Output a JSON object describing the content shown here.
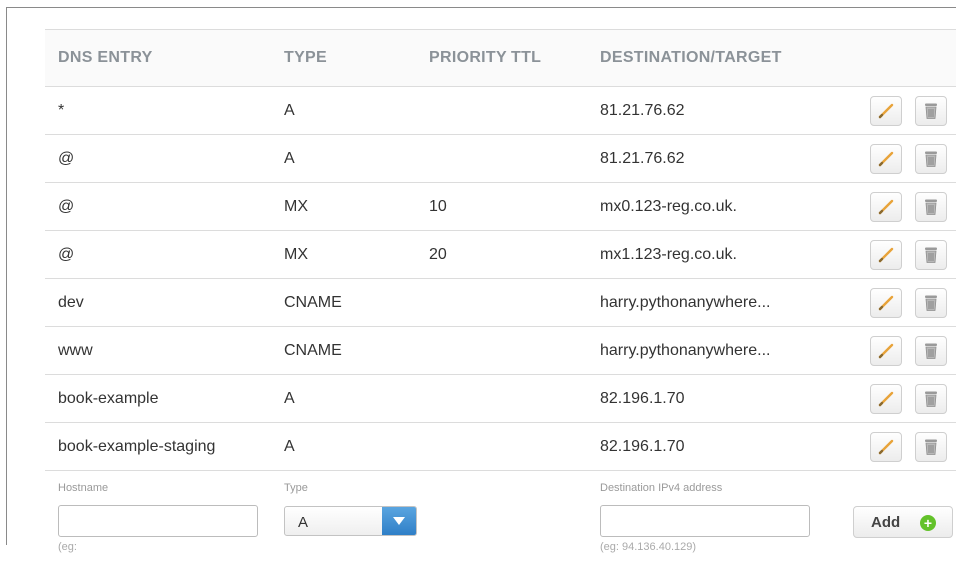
{
  "table": {
    "headers": {
      "entry": "DNS ENTRY",
      "type": "TYPE",
      "priority": "PRIORITY",
      "ttl": "TTL",
      "destination": "DESTINATION/TARGET"
    },
    "rows": [
      {
        "entry": "*",
        "type": "A",
        "priority": "",
        "ttl": "",
        "destination": "81.21.76.62"
      },
      {
        "entry": "@",
        "type": "A",
        "priority": "",
        "ttl": "",
        "destination": "81.21.76.62"
      },
      {
        "entry": "@",
        "type": "MX",
        "priority": "10",
        "ttl": "",
        "destination": "mx0.123-reg.co.uk."
      },
      {
        "entry": "@",
        "type": "MX",
        "priority": "20",
        "ttl": "",
        "destination": "mx1.123-reg.co.uk."
      },
      {
        "entry": "dev",
        "type": "CNAME",
        "priority": "",
        "ttl": "",
        "destination": "harry.pythonanywhere..."
      },
      {
        "entry": "www",
        "type": "CNAME",
        "priority": "",
        "ttl": "",
        "destination": "harry.pythonanywhere..."
      },
      {
        "entry": "book-example",
        "type": "A",
        "priority": "",
        "ttl": "",
        "destination": "82.196.1.70"
      },
      {
        "entry": "book-example-staging",
        "type": "A",
        "priority": "",
        "ttl": "",
        "destination": "82.196.1.70"
      }
    ],
    "icons": {
      "edit": "pencil-icon",
      "delete": "trash-icon"
    }
  },
  "form": {
    "hostname_label": "Hostname",
    "hostname_value": "",
    "hostname_hint": "(eg:",
    "type_label": "Type",
    "type_value": "A",
    "destination_label": "Destination IPv4 address",
    "destination_value": "",
    "destination_hint": "(eg: 94.136.40.129)",
    "add_label": "Add",
    "add_icon": "plus-circle-icon"
  },
  "colors": {
    "header_text": "#8b9298",
    "select_accent": "#2f7fc7",
    "add_icon": "#63c22a",
    "pencil": "#e8a33a"
  }
}
